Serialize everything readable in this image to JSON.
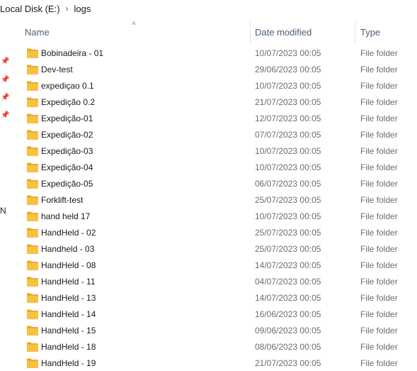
{
  "breadcrumb": {
    "items": [
      "Local Disk (E:)",
      "logs"
    ],
    "separator": "›"
  },
  "nav": {
    "letter": "N"
  },
  "columns": {
    "name": "Name",
    "date_modified": "Date modified",
    "type": "Type"
  },
  "colors": {
    "folder": "#f5c242",
    "folder_dark": "#e6a817"
  },
  "files": [
    {
      "name": "Bobinadeira - 01",
      "date": "10/07/2023 00:05",
      "type": "File folder"
    },
    {
      "name": "Dev-test",
      "date": "29/06/2023 00:05",
      "type": "File folder"
    },
    {
      "name": "expediçao 0.1",
      "date": "10/07/2023 00:05",
      "type": "File folder"
    },
    {
      "name": "Expedição 0.2",
      "date": "21/07/2023 00:05",
      "type": "File folder"
    },
    {
      "name": "Expedição-01",
      "date": "12/07/2023 00:05",
      "type": "File folder"
    },
    {
      "name": "Expedição-02",
      "date": "07/07/2023 00:05",
      "type": "File folder"
    },
    {
      "name": "Expedição-03",
      "date": "10/07/2023 00:05",
      "type": "File folder"
    },
    {
      "name": "Expedição-04",
      "date": "10/07/2023 00:05",
      "type": "File folder"
    },
    {
      "name": "Expedição-05",
      "date": "06/07/2023 00:05",
      "type": "File folder"
    },
    {
      "name": "Forklift-test",
      "date": "25/07/2023 00:05",
      "type": "File folder"
    },
    {
      "name": "hand held 17",
      "date": "10/07/2023 00:05",
      "type": "File folder"
    },
    {
      "name": "HandHeld - 02",
      "date": "25/07/2023 00:05",
      "type": "File folder"
    },
    {
      "name": "Handheld - 03",
      "date": "25/07/2023 00:05",
      "type": "File folder"
    },
    {
      "name": "HandHeld - 08",
      "date": "14/07/2023 00:05",
      "type": "File folder"
    },
    {
      "name": "HandHeld - 11",
      "date": "04/07/2023 00:05",
      "type": "File folder"
    },
    {
      "name": "HandHeld - 13",
      "date": "14/07/2023 00:05",
      "type": "File folder"
    },
    {
      "name": "HandHeld - 14",
      "date": "16/06/2023 00:05",
      "type": "File folder"
    },
    {
      "name": "HandHeld - 15",
      "date": "09/06/2023 00:05",
      "type": "File folder"
    },
    {
      "name": "HandHeld - 18",
      "date": "08/06/2023 00:05",
      "type": "File folder"
    },
    {
      "name": "HandHeld - 19",
      "date": "21/07/2023 00:05",
      "type": "File folder"
    }
  ]
}
